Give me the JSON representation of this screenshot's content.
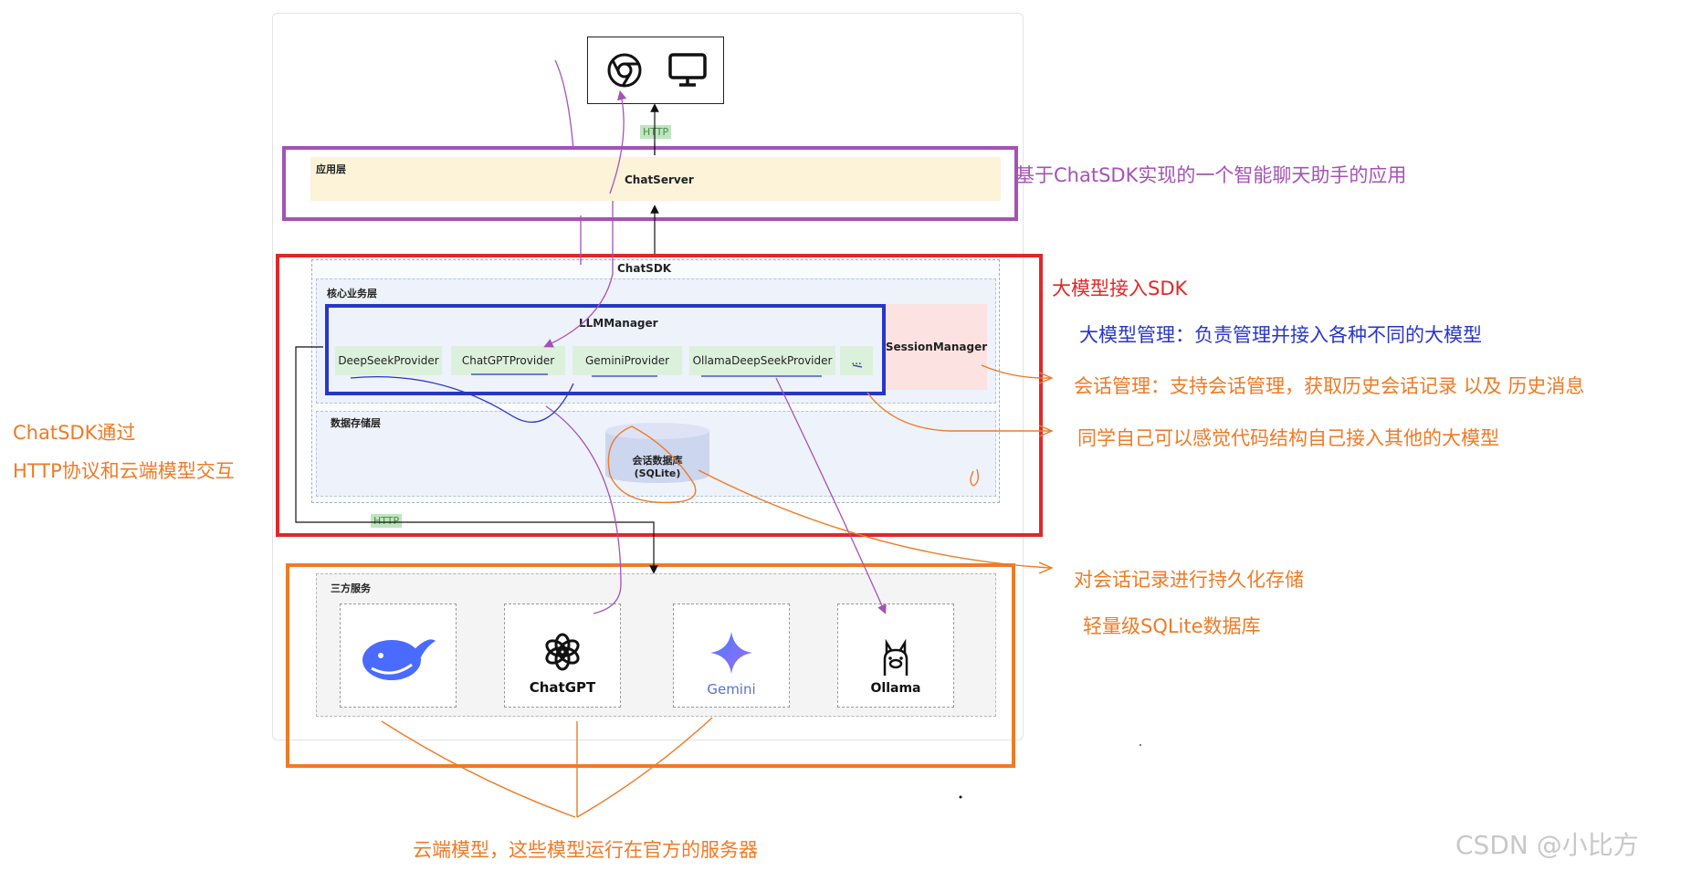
{
  "diagram": {
    "client": {
      "icons": [
        "chrome-icon",
        "monitor-icon"
      ]
    },
    "http_top": "HTTP",
    "app_layer": {
      "label": "应用层",
      "server": "ChatServer"
    },
    "sdk": {
      "title": "ChatSDK",
      "core_layer": "核心业务层",
      "llm_manager": "LLMManager",
      "providers": [
        "DeepSeekProvider",
        "ChatGPTProvider",
        "GeminiProvider",
        "OllamaDeepSeekProvider",
        "..."
      ],
      "session_manager": "SessionManager",
      "storage_layer": "数据存储层",
      "db_line1": "会话数据库",
      "db_line2": "(SQLite)"
    },
    "http_bottom": "HTTP",
    "third_party": {
      "label": "三方服务",
      "models": [
        {
          "name": "",
          "icon": "deepseek-whale-icon"
        },
        {
          "name": "ChatGPT",
          "icon": "openai-knot-icon"
        },
        {
          "name": "Gemini",
          "icon": "gemini-star-icon"
        },
        {
          "name": "Ollama",
          "icon": "ollama-llama-icon"
        }
      ]
    }
  },
  "annotations": {
    "app": "基于ChatSDK实现的一个智能聊天助手的应用",
    "sdk": "大模型接入SDK",
    "llm": "大模型管理：负责管理并接入各种不同的大模型",
    "session": "会话管理：支持会话管理，获取历史会话记录 以及 历史消息",
    "extend": "同学自己可以感觉代码结构自己接入其他的大模型",
    "left_line1": "ChatSDK通过",
    "left_line2": "HTTP协议和云端模型交互",
    "persist": "对会话记录进行持久化存储",
    "sqlite": "轻量级SQLite数据库",
    "cloud": "云端模型，这些模型运行在官方的服务器"
  },
  "colors": {
    "purple": "#a552b5",
    "red": "#e02828",
    "blue": "#2836c8",
    "orange": "#f07a25",
    "app_fill": "#fdf3d9",
    "provider_fill": "#dcf1dc",
    "session_fill": "#fde2e2",
    "deepseek": "#4a6bff"
  },
  "watermark": "CSDN @小比方"
}
